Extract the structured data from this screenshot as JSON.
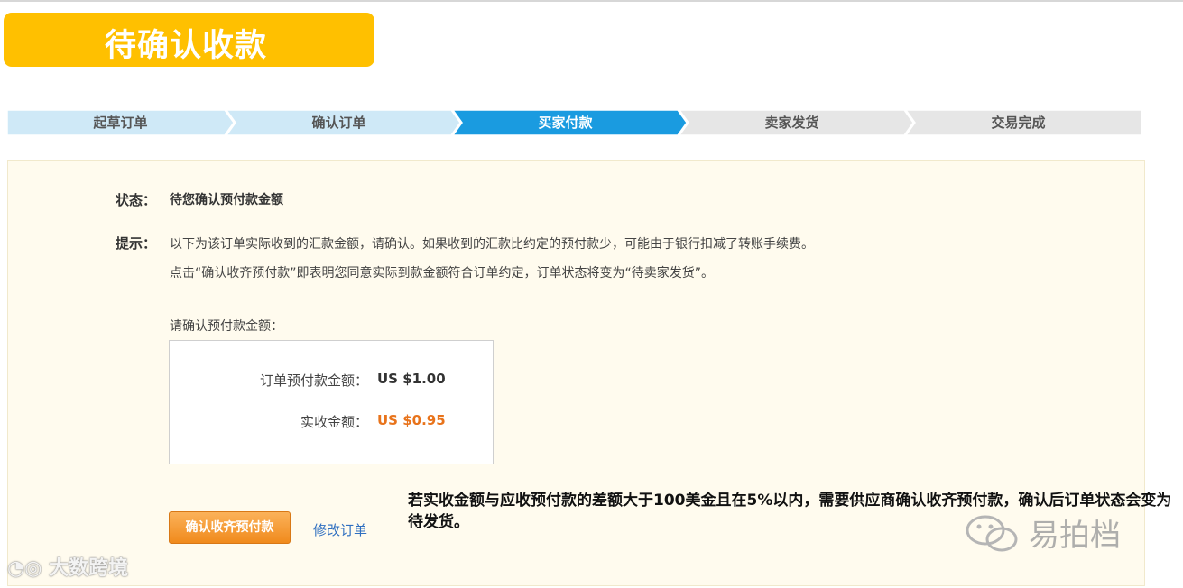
{
  "banner": {
    "title": "待确认收款"
  },
  "steps": [
    {
      "label": "起草订单",
      "state": "done"
    },
    {
      "label": "确认订单",
      "state": "done"
    },
    {
      "label": "买家付款",
      "state": "active"
    },
    {
      "label": "卖家发货",
      "state": "pending"
    },
    {
      "label": "交易完成",
      "state": "pending"
    }
  ],
  "status": {
    "label": "状态：",
    "value": "待您确认预付款金额"
  },
  "hint": {
    "label": "提示：",
    "line1": "以下为该订单实际收到的汇款金额，请确认。如果收到的汇款比约定的预付款少，可能由于银行扣减了转账手续费。",
    "line2": "点击“确认收齐预付款”即表明您同意实际到款金额符合订单约定，订单状态将变为“待卖家发货”。"
  },
  "confirm_prompt": "请确认预付款金额：",
  "amounts": {
    "order_label": "订单预付款金额：",
    "order_value": "US $1.00",
    "received_label": "实收金额：",
    "received_value": "US $0.95"
  },
  "actions": {
    "confirm": "确认收齐预付款",
    "modify": "修改订单"
  },
  "note": "若实收金额与应收预付款的差额大于100美金且在5%以内，需要供应商确认收齐预付款，确认后订单状态会变为待发货。",
  "watermarks": {
    "left": "大数跨境",
    "right": "易拍档"
  },
  "colors": {
    "banner": "#ffc000",
    "step_done": "#cfe9f7",
    "step_active": "#1a9be0",
    "step_pending": "#e6e6e6",
    "panel_bg": "#fffbee",
    "accent_orange": "#e8731b",
    "link_blue": "#2f6fc0"
  }
}
